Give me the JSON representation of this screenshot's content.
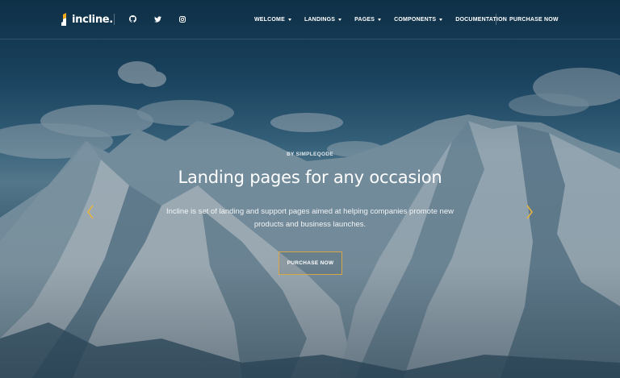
{
  "brand": {
    "name": "incline.",
    "accent_color": "#f2a91d"
  },
  "header": {
    "social": [
      {
        "icon": "github-icon"
      },
      {
        "icon": "twitter-icon"
      },
      {
        "icon": "instagram-icon"
      }
    ],
    "nav": [
      {
        "label": "Welcome",
        "has_dropdown": true
      },
      {
        "label": "Landings",
        "has_dropdown": true
      },
      {
        "label": "Pages",
        "has_dropdown": true
      },
      {
        "label": "Components",
        "has_dropdown": true
      },
      {
        "label": "Documentation",
        "has_dropdown": false
      }
    ],
    "purchase_label": "Purchase Now"
  },
  "hero": {
    "eyebrow": "BY SIMPLEQODE",
    "headline": "Landing pages for any occasion",
    "subtitle": "Incline is set of landing and support pages aimed at helping companies promote new products and business launches.",
    "cta_label": "Purchase Now",
    "cta_border_color": "#d7a645",
    "arrow_color": "#e9b33f",
    "prev_icon": "chevron-left-icon",
    "next_icon": "chevron-right-icon"
  }
}
